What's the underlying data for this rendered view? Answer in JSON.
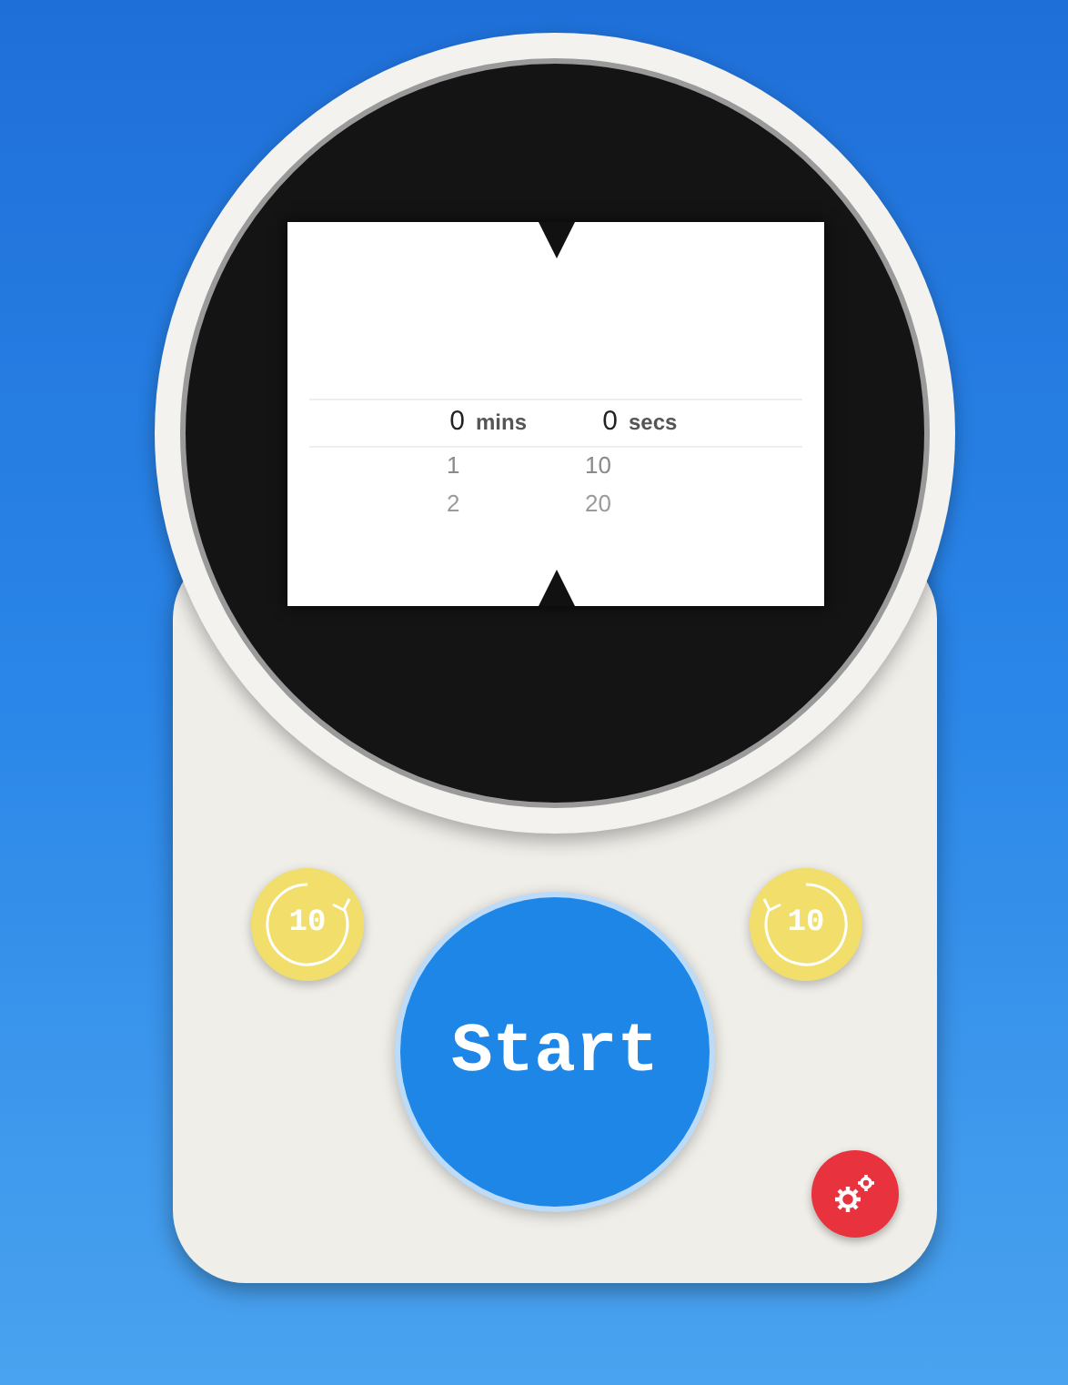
{
  "picker": {
    "selected_row": {
      "minutes": "0",
      "minutes_unit": "mins",
      "seconds": "0",
      "seconds_unit": "secs"
    },
    "rows": [
      {
        "minutes": "1",
        "seconds": "10"
      },
      {
        "minutes": "2",
        "seconds": "20"
      }
    ]
  },
  "rewind_button": {
    "label": "10"
  },
  "forward_button": {
    "label": "10"
  },
  "start_button": {
    "label": "Start"
  }
}
